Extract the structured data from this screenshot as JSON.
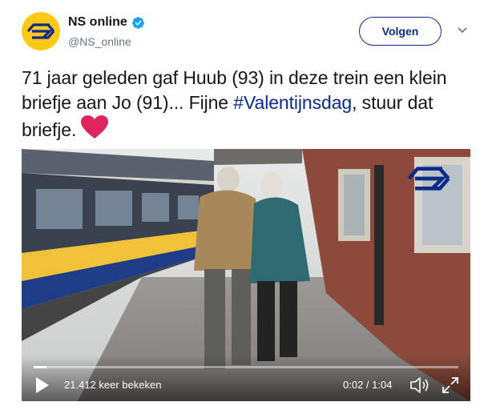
{
  "account": {
    "name": "NS online",
    "handle": "@NS_online",
    "avatar_color": "#ffc917",
    "verified_icon": "verified-badge-icon"
  },
  "follow_button": {
    "label": "Volgen"
  },
  "tweet": {
    "text_part1": "71 jaar geleden gaf Huub (93) in deze trein een klein briefje aan Jo (91)... Fijne ",
    "hashtag": "#Valentijnsdag",
    "text_part2": ", stuur dat briefje.",
    "emoji": "heart-icon"
  },
  "video": {
    "views": "21.412 keer bekeken",
    "time": "0:02 / 1:04",
    "progress": 0.03,
    "accent": "#0b2a8a"
  },
  "colors": {
    "link": "#0b2a8a",
    "heart": "#e0245e"
  }
}
